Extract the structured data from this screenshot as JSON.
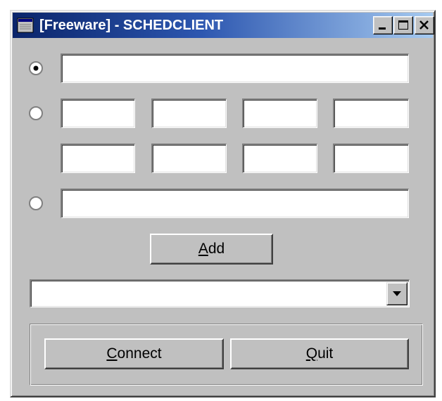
{
  "window": {
    "title": "[Freeware] - SCHEDCLIENT",
    "controls": {
      "minimize": "minimize-icon",
      "maximize": "maximize-icon",
      "close": "close-icon"
    }
  },
  "options": [
    {
      "selected": true,
      "value": ""
    },
    {
      "selected": false,
      "values": [
        "",
        "",
        "",
        "",
        "",
        "",
        "",
        ""
      ]
    },
    {
      "selected": false,
      "value": ""
    }
  ],
  "add_button": {
    "prefix": "",
    "accel": "A",
    "rest": "dd"
  },
  "dropdown": {
    "selected": "",
    "arrow_icon": "chevron-down-icon"
  },
  "connect_button": {
    "prefix": "",
    "accel": "C",
    "rest": "onnect"
  },
  "quit_button": {
    "prefix": "",
    "accel": "Q",
    "rest": "uit"
  }
}
